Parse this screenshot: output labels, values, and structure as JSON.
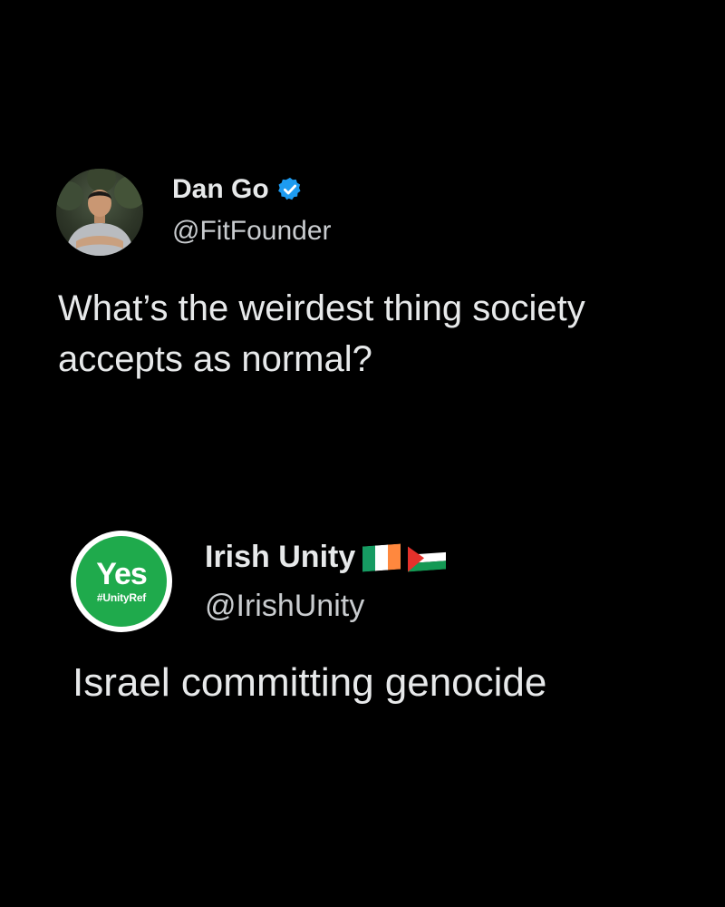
{
  "posts": [
    {
      "display_name": "Dan Go",
      "handle": "@FitFounder",
      "verified": true,
      "text": "What’s the weirdest thing society accepts as normal?",
      "avatar": "photo-of-man-icon",
      "accent": "#1d9bf0"
    },
    {
      "display_name": "Irish Unity",
      "flags": [
        "ireland-flag-icon",
        "palestine-flag-icon"
      ],
      "handle": "@IrishUnity",
      "text": "Israel committing genocide",
      "avatar": {
        "word": "Yes",
        "tag": "#UnityRef",
        "color": "#1faa4c"
      }
    }
  ]
}
